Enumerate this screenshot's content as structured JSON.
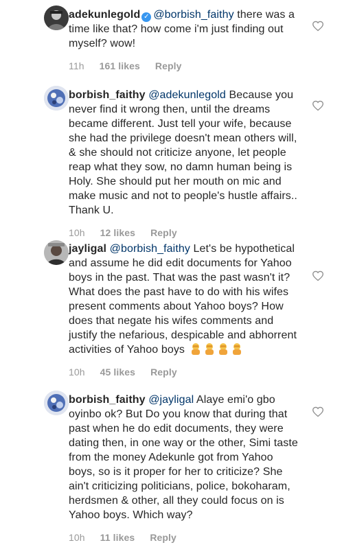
{
  "comments": [
    {
      "username": "adekunlegold",
      "verified": true,
      "mention": "@borbish_faithy",
      "text": "there was a time like that? how come i'm just finding out myself? wow!",
      "time": "11h",
      "likes": "161 likes",
      "reply": "Reply"
    },
    {
      "username": "borbish_faithy",
      "verified": false,
      "mention": "@adekunlegold",
      "text": "Because you never find it wrong then, until the dreams became different. Just tell your wife, because she had the privilege doesn't mean others will, & she should not criticize anyone, let people reap what they sow, no damn human being is Holy. She should put her mouth on mic and make music and not to people's hustle affairs.. Thank U.",
      "time": "10h",
      "likes": "12 likes",
      "reply": "Reply"
    },
    {
      "username": "jayligal",
      "verified": false,
      "mention": "@borbish_faithy",
      "text": "Let's be hypothetical and assume he did edit documents for Yahoo boys in the past. That was the past wasn't it? What does the past have to do with his wifes present comments about Yahoo boys? How does that negate his wifes comments and justify the nefarious, despicable and abhorrent activities of Yahoo boys",
      "emoji": "person-facepalming-emoji",
      "time": "10h",
      "likes": "45 likes",
      "reply": "Reply"
    },
    {
      "username": "borbish_faithy",
      "verified": false,
      "mention": "@jayligal",
      "text": "Alaye emi'o gbo oyinbo ok? But Do you know that during that past when he do edit documents, they were dating then, in one way or the other, Simi taste from the money Adekunle got from Yahoo boys, so is it proper for her to criticize? She ain't criticizing politicians, police, bokoharam, herdsmen & other, all they could focus on is Yahoo boys. Which way?",
      "time": "10h",
      "likes": "11 likes",
      "reply": "Reply"
    }
  ],
  "icons": {
    "heart": "heart-outline-icon",
    "verified": "verified-badge-icon"
  },
  "colors": {
    "text": "#262626",
    "meta": "#999999",
    "verified": "#3897f0",
    "heart_stroke": "#8e8e8e"
  }
}
